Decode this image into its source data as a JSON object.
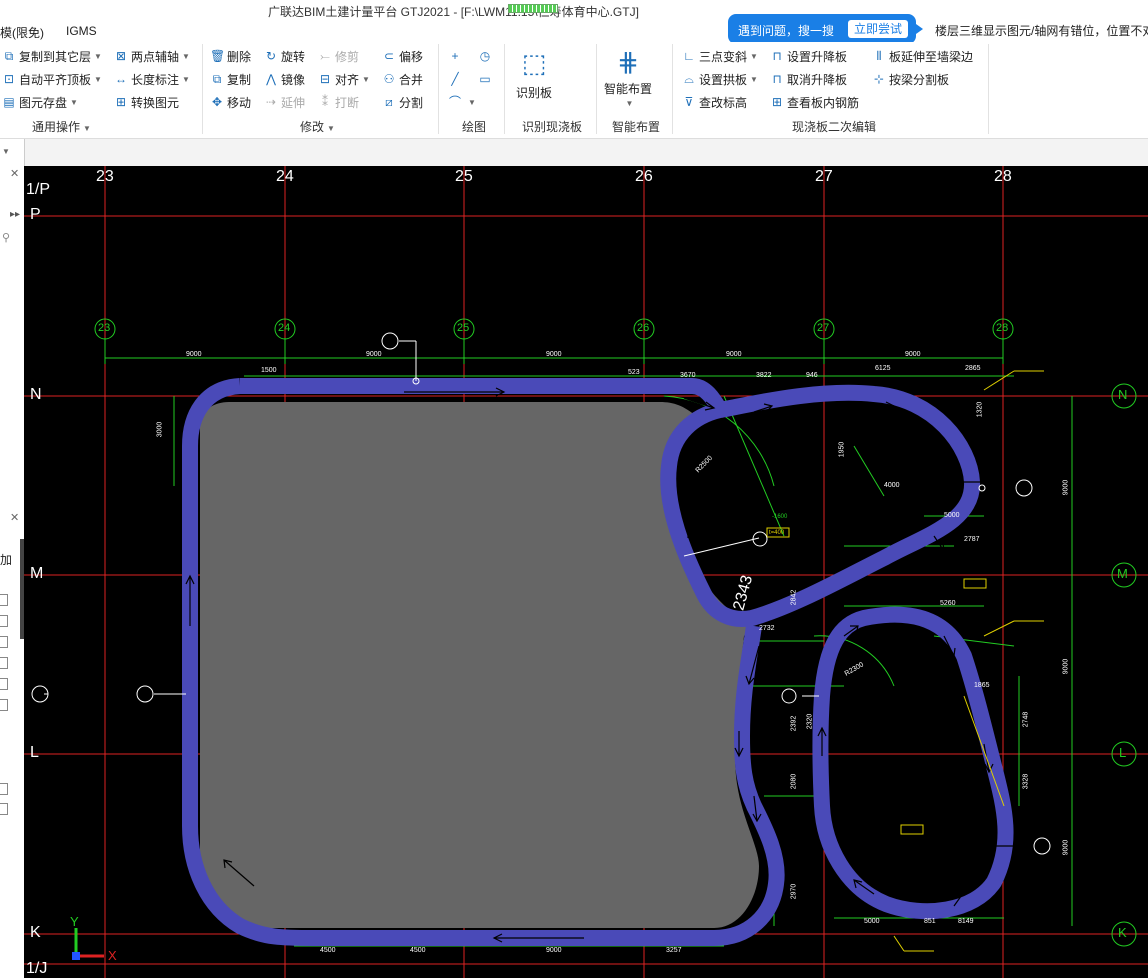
{
  "window": {
    "title": "广联达BIM土建计量平台 GTJ2021 - [F:\\LWM11.15\\仁寿体育中心.GTJ]",
    "menu": [
      "模(限免)",
      "IGMS"
    ]
  },
  "search_tip": {
    "text": "遇到问题，搜一搜",
    "button": "立即尝试",
    "message": "楼层三维显示图元/轴网有错位，位置不对"
  },
  "ribbon": {
    "general_ops": {
      "items": [
        "复制到其它层",
        "两点辅轴",
        "自动平齐顶板",
        "长度标注",
        "图元存盘",
        "转换图元"
      ],
      "label": "通用操作"
    },
    "modify": {
      "items": [
        "删除",
        "旋转",
        "修剪",
        "偏移",
        "复制",
        "镜像",
        "对齐",
        "合并",
        "移动",
        "延伸",
        "打断",
        "分割"
      ],
      "label": "修改"
    },
    "draw": {
      "label": "绘图"
    },
    "identify": {
      "button": "识别板",
      "label": "识别现浇板"
    },
    "smart": {
      "button": "智能布置",
      "label": "智能布置"
    },
    "secondary": {
      "items": [
        "三点变斜",
        "设置升降板",
        "板延伸至墙梁边",
        "设置拱板",
        "取消升降板",
        "按梁分割板",
        "查改标高",
        "查看板内钢筋"
      ],
      "label": "现浇板二次编辑"
    }
  },
  "left_panel": {
    "label": "加"
  },
  "cad": {
    "axes_top": [
      "23",
      "24",
      "25",
      "26",
      "27",
      "28"
    ],
    "axes_circles": [
      "23",
      "24",
      "25",
      "26",
      "27",
      "28"
    ],
    "axes_right": [
      "N",
      "M",
      "L",
      "K"
    ],
    "axes_left": [
      "1/P",
      "P",
      "N",
      "M",
      "L",
      "K",
      "1/J"
    ],
    "dims_top": [
      "9000",
      "9000",
      "9000",
      "9000",
      "9000"
    ],
    "dims_second": [
      "1500",
      "523",
      "3670",
      "3822",
      "946",
      "6125",
      "2865"
    ],
    "dims_bottom": [
      "4500",
      "4500",
      "9000",
      "3257",
      "5000",
      "851",
      "8149"
    ],
    "dims_vertical_left": [
      "3000"
    ],
    "dims_vertical_right": [
      "9000",
      "9000",
      "9000",
      "3328",
      "2748",
      "1865"
    ],
    "big_label": "2343",
    "small_labels": [
      "1950",
      "2787",
      "5260",
      "2732",
      "2842",
      "2392",
      "2320",
      "2080",
      "2970",
      "5000",
      "1320",
      "4000",
      "R2300",
      "R2500",
      "-1600",
      "t=400"
    ],
    "axis_indicator": {
      "x": "X",
      "y": "Y"
    }
  },
  "colors": {
    "slab_gray": "#666666",
    "beam_blue": "#4a4ab8",
    "axis_red": "#dd2222",
    "green": "#22cc22",
    "yellow": "#e0d000",
    "accent_blue": "#1a7fe6"
  }
}
